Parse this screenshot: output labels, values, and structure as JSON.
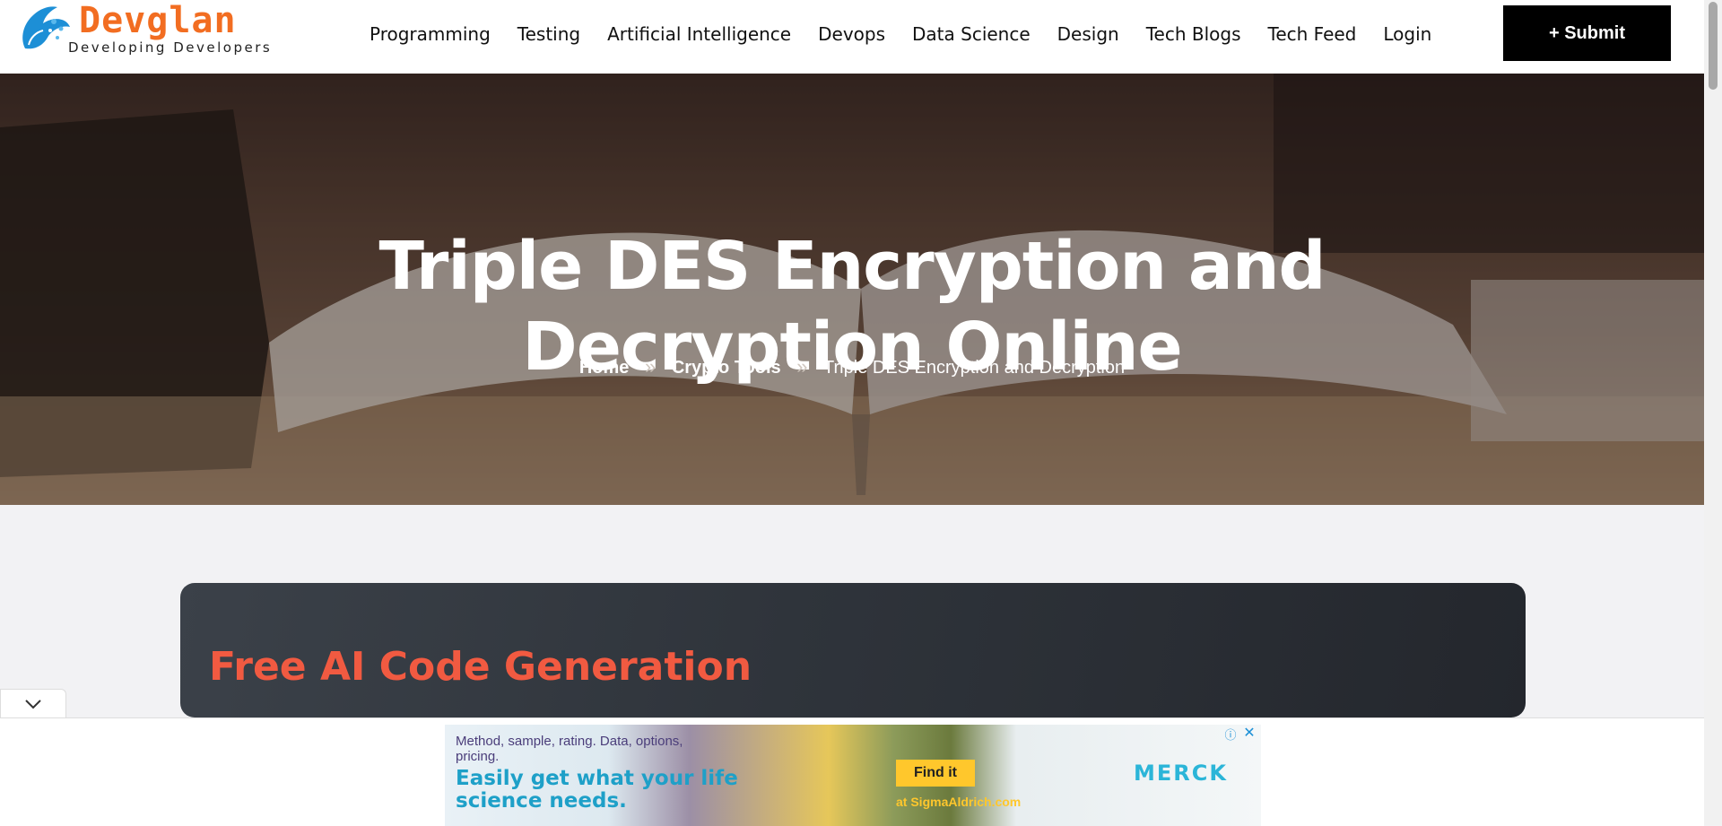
{
  "header": {
    "logo_name": "Devglan",
    "logo_tagline": "Developing Developers",
    "nav": [
      {
        "label": "Programming"
      },
      {
        "label": "Testing"
      },
      {
        "label": "Artificial Intelligence"
      },
      {
        "label": "Devops"
      },
      {
        "label": "Data Science"
      },
      {
        "label": "Design"
      },
      {
        "label": "Tech Blogs"
      },
      {
        "label": "Tech Feed"
      },
      {
        "label": "Login"
      }
    ],
    "submit_label": "+ Submit"
  },
  "hero": {
    "title": "Triple DES Encryption and Decryption Online",
    "breadcrumb": {
      "home": "Home",
      "section": "Crypto Tools",
      "current": "Triple DES Encryption and Decryption",
      "separator_icon": "double-chevron-right-icon"
    }
  },
  "card": {
    "title": "Free AI Code Generation"
  },
  "ad": {
    "small_text": "Method, sample, rating. Data, options, pricing.",
    "headline": "Easily get what your life science needs.",
    "button": "Find it",
    "url_text": "at SigmaAldrich.com",
    "brand": "MERCK",
    "info_icon": "info-icon",
    "close_icon": "close-icon"
  },
  "colors": {
    "logo_orange": "#f26d21",
    "card_title": "#f15a41",
    "submit_bg": "#000000",
    "ad_button": "#ffc72c",
    "ad_brand": "#2bb5d8"
  }
}
